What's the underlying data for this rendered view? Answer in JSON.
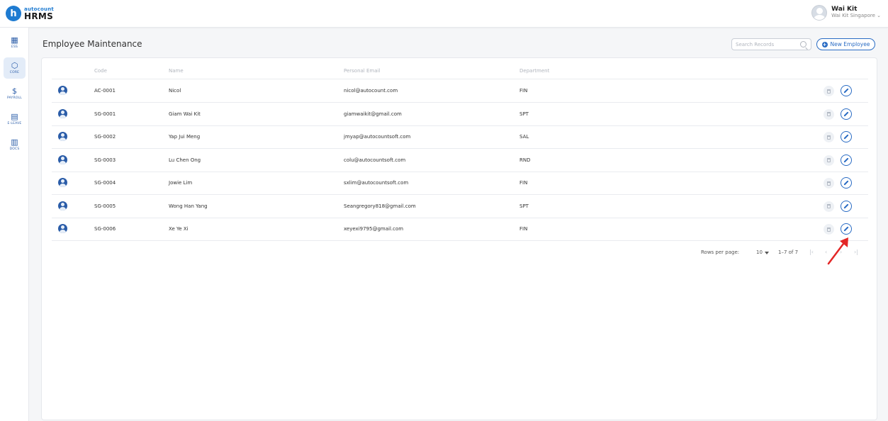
{
  "app": {
    "logo_small": "autocount",
    "logo_big": "HRMS",
    "logo_letter": "h"
  },
  "user": {
    "name": "Wai Kit",
    "company": "Wai Kit Singapore ⌄"
  },
  "sidebar": {
    "items": [
      {
        "label": "ESS",
        "icon": "ess-icon",
        "glyph": "▦"
      },
      {
        "label": "CORE",
        "icon": "cube-icon",
        "glyph": "⬡"
      },
      {
        "label": "PAYROLL",
        "icon": "dollar-icon",
        "glyph": "$"
      },
      {
        "label": "E-LEAVE",
        "icon": "calendar-icon",
        "glyph": "▤"
      },
      {
        "label": "DOCS",
        "icon": "document-icon",
        "glyph": "▥"
      }
    ]
  },
  "header": {
    "title": "Employee Maintenance",
    "search_placeholder": "Search Records",
    "new_button": "New Employee",
    "new_button_icon": "+"
  },
  "table": {
    "columns": {
      "code": "Code",
      "name": "Name",
      "email": "Personal Email",
      "department": "Department"
    },
    "rows": [
      {
        "code": "AC-0001",
        "name": "Nicol",
        "email": "nicol@autocount.com",
        "department": "FIN"
      },
      {
        "code": "SG-0001",
        "name": "Giam Wai Kit",
        "email": "giamwaikit@gmail.com",
        "department": "SPT"
      },
      {
        "code": "SG-0002",
        "name": "Yap Jui Meng",
        "email": "jmyap@autocountsoft.com",
        "department": "SAL"
      },
      {
        "code": "SG-0003",
        "name": "Lu Chen Ong",
        "email": "colu@autocountsoft.com",
        "department": "RND"
      },
      {
        "code": "SG-0004",
        "name": "Jowie Lim",
        "email": "sxlim@autocountsoft.com",
        "department": "FIN"
      },
      {
        "code": "SG-0005",
        "name": "Wong Han Yang",
        "email": "Seangregory818@gmail.com",
        "department": "SPT"
      },
      {
        "code": "SG-0006",
        "name": "Xe Ye Xi",
        "email": "xeyexi9795@gmail.com",
        "department": "FIN"
      }
    ]
  },
  "pagination": {
    "rows_per_page_label": "Rows per page:",
    "rows_per_page": "10",
    "range": "1–7 of 7",
    "first": "|‹",
    "prev": "‹",
    "next": "›",
    "last": "›|"
  },
  "colors": {
    "accent": "#2a6cc4",
    "annotation": "#e32626"
  }
}
